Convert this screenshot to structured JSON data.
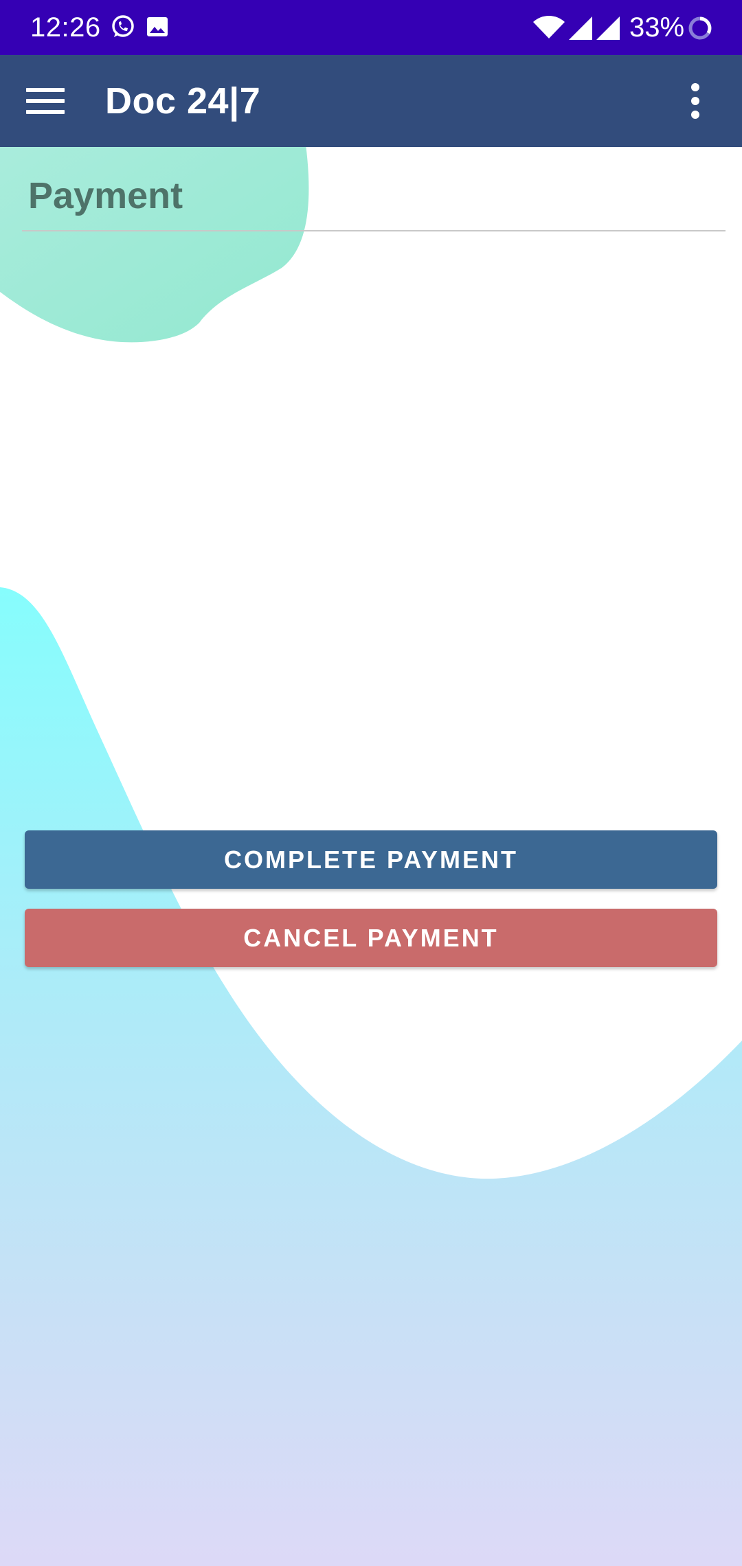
{
  "status_bar": {
    "time": "12:26",
    "battery_percent": "33%",
    "icons": [
      "whatsapp-icon",
      "image-icon",
      "wifi-icon",
      "signal-icon",
      "signal-icon",
      "battery-saver-ring-icon"
    ]
  },
  "app_bar": {
    "title": "Doc 24|7",
    "menu_icon": "hamburger-menu-icon",
    "overflow_icon": "more-vertical-icon"
  },
  "page": {
    "heading": "Payment"
  },
  "actions": {
    "complete_label": "COMPLETE PAYMENT",
    "cancel_label": "CANCEL PAYMENT"
  },
  "colors": {
    "status_bar": "#3500b4",
    "app_bar": "#324c7c",
    "complete_button": "#3c6893",
    "cancel_button": "#c96b6b",
    "heading_text": "#4e7369"
  }
}
